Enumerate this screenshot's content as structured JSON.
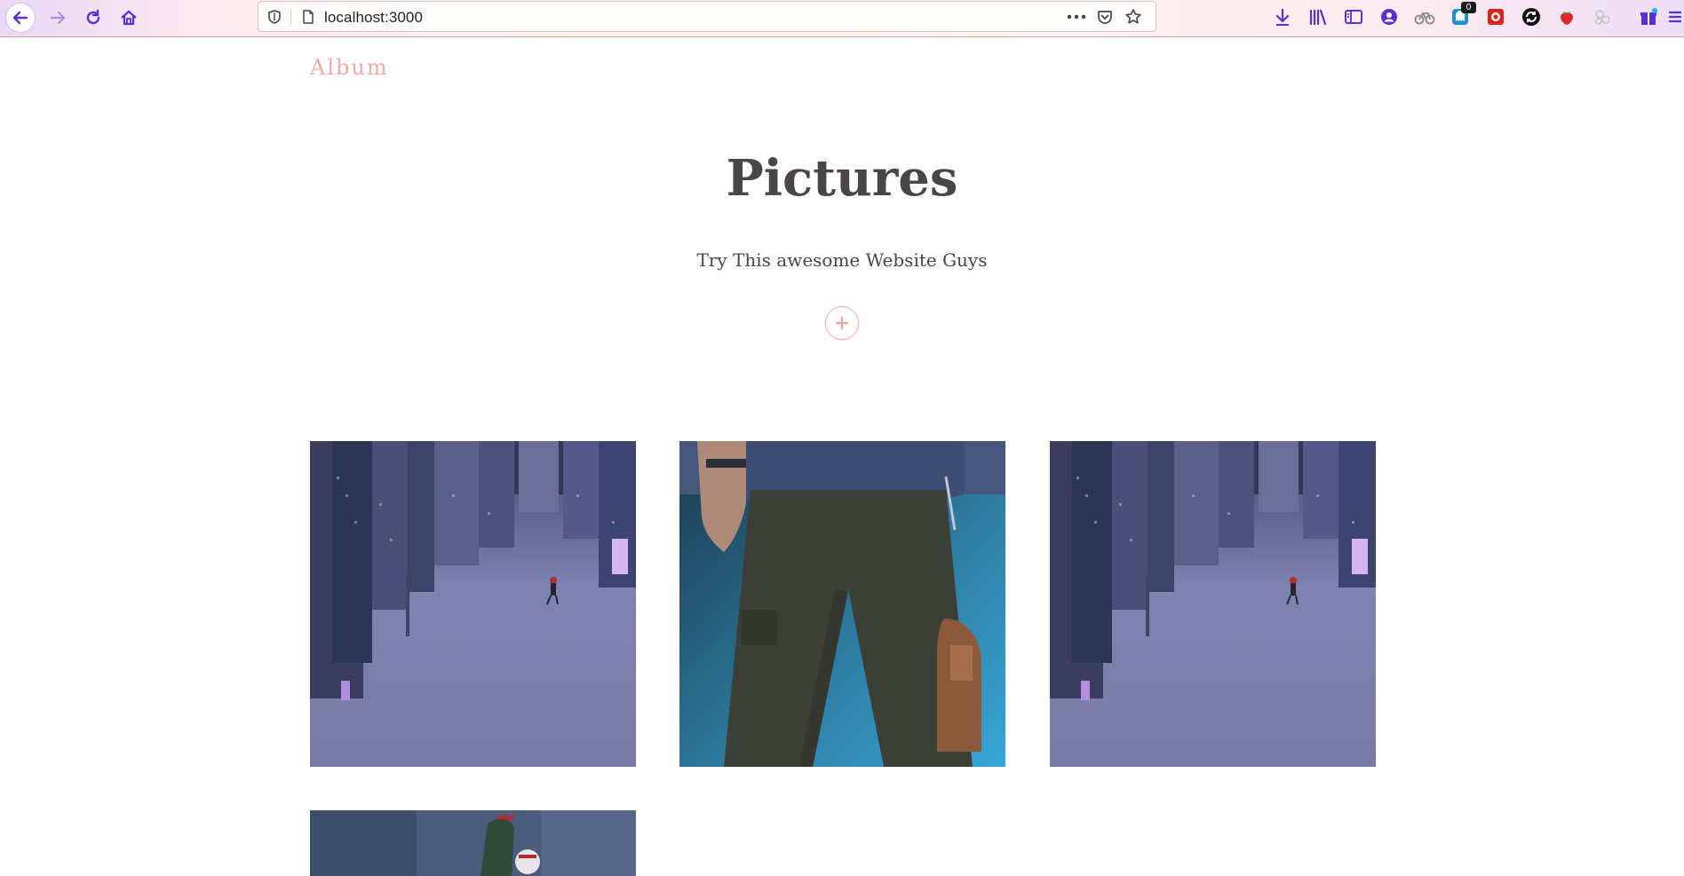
{
  "browser": {
    "url": "localhost:3000",
    "extension_badge_count": "0",
    "accent_color": "#5b2fd6"
  },
  "site": {
    "brand": "Album",
    "title": "Pictures",
    "subtitle": "Try This awesome Website Guys",
    "add_symbol": "+",
    "accent_color": "#f5a9a7"
  },
  "gallery": {
    "photos": [
      {
        "subject": "upside-down-city-falling-figure"
      },
      {
        "subject": "person-in-cargo-pants-with-bag"
      },
      {
        "subject": "upside-down-city-falling-figure"
      },
      {
        "subject": "spider-verse-city-scene"
      }
    ]
  }
}
